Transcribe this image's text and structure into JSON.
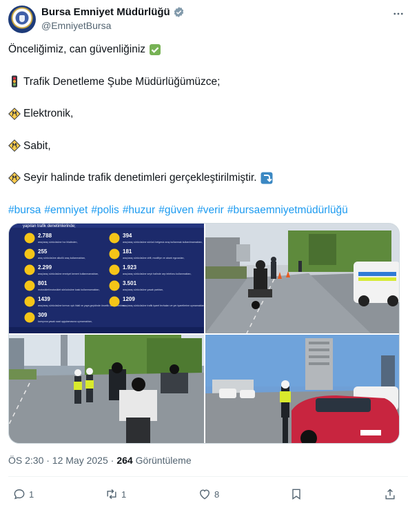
{
  "account": {
    "display_name": "Bursa Emniyet Müdürlüğü",
    "handle": "@EmniyetBursa",
    "verified_color": "#829aab"
  },
  "tweet": {
    "line1": "Önceliğimiz, can güvenliğiniz",
    "line2": "Trafik Denetleme Şube Müdürlüğümüzce;",
    "line3": "Elektronik,",
    "line4": "Sabit,",
    "line5": "Seyir halinde trafik denetimleri gerçekleştirilmiştir.",
    "hashtags": [
      "#bursa",
      "#emniyet",
      "#polis",
      "#huzur",
      "#güven",
      "#verir",
      "#bursaemniyetmüdürlüğü"
    ],
    "emoji_icons": [
      "check-mark-icon",
      "traffic-light-icon",
      "warning-sign-icon",
      "arrow-down-icon"
    ]
  },
  "infographic": {
    "heading": "yapılan trafik denetimlerinde;",
    "left_items": [
      {
        "number": "2.788",
        "text": "araç/araç sürücüsüne hız ihlalinden,"
      },
      {
        "number": "255",
        "text": "araç sürücüsüne alkollü araç kullanmaktan,"
      },
      {
        "number": "2.299",
        "text": "araç/araç sürücüsüne emniyet kemeri kullanmamaktan,"
      },
      {
        "number": "801",
        "text": "motosiklet/motosiklet sürücüsüne kask kullanmamaktan,"
      },
      {
        "number": "1439",
        "text": "araç/araç sürücüsüne kırmızı ışık ihlali ve yaya geçidinde öncelik vermemekten,"
      },
      {
        "number": "309",
        "text": "kamyona yasak saat uygulamasına uymamaktan,"
      }
    ],
    "right_items": [
      {
        "number": "394",
        "text": "araç/araç sürücüsüne sürücü belgesiz araç kullanmak kullanılmamaktan,"
      },
      {
        "number": "181",
        "text": "araç/araç sürücüsüne drift, modifiye ve abartı egzozdan,"
      },
      {
        "number": "1.923",
        "text": "araç/araç sürücüsüne seyir halinde cep telefonu kullanmaktan,"
      },
      {
        "number": "3.501",
        "text": "araç/araç sürücüsüne yasak parktan,"
      },
      {
        "number": "1209",
        "text": "araç/araç sürücüsüne trafik işaret levhaları ve yer işaretlerine uymamaktan,"
      }
    ]
  },
  "meta": {
    "time": "ÖS 2:30 · 12 May 2025 ·",
    "views_count": "264",
    "views_label": "Görüntüleme"
  },
  "actions": {
    "replies": "1",
    "reposts": "1",
    "likes": "8"
  },
  "colors": {
    "link": "#1d9bf0",
    "text": "#0f1419",
    "muted": "#536471",
    "infographic_bg": "#1c2a6b",
    "infographic_accent": "#f5c518"
  }
}
